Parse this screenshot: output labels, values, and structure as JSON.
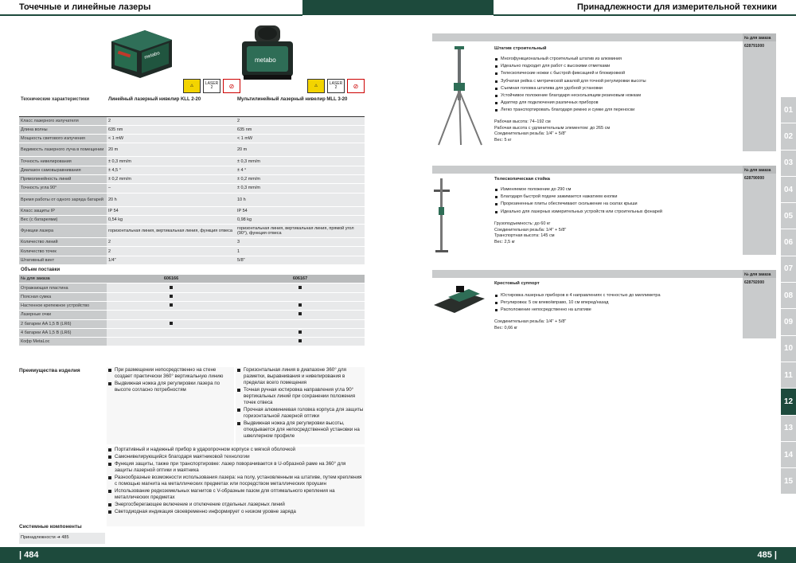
{
  "header": {
    "left_title": "Точечные и линейные лазеры",
    "right_title": "Принадлежности для измерительной техники"
  },
  "footer": {
    "left_page": "| 484",
    "right_page": "485 |"
  },
  "products": [
    {
      "name": "Линейный лазерный нивелир KLL 2-20",
      "brand": "metabo"
    },
    {
      "name": "Мультилинейный лазерный нивелир MLL 3-20",
      "brand": "metabo"
    }
  ],
  "laser_badge": {
    "class_label": "LASER 2",
    "warning": "⚠"
  },
  "spec_table": {
    "header": "Технические характеристики",
    "rows": [
      {
        "k": "Класс лазерного излучателя",
        "v1": "2",
        "v2": "2"
      },
      {
        "k": "Длина волны",
        "v1": "635 nm",
        "v2": "635 nm"
      },
      {
        "k": "Мощность светового излучения",
        "v1": "< 1 mW",
        "v2": "< 1 mW"
      },
      {
        "k": "Видимость лазерного луча в помещении",
        "v1": "20 m",
        "v2": "20 m",
        "tall": true
      },
      {
        "k": "Точность нивелирования",
        "v1": "± 0,3 mm/m",
        "v2": "± 0,3 mm/m"
      },
      {
        "k": "Диапазон самовыравнивания",
        "v1": "± 4,5 °",
        "v2": "± 4 °"
      },
      {
        "k": "Прямолинейность линий",
        "v1": "± 0,2 mm/m",
        "v2": "± 0,2 mm/m"
      },
      {
        "k": "Точность угла 90°",
        "v1": "–",
        "v2": "± 0,3 mm/m"
      },
      {
        "k": "Время работы от одного заряда батарей",
        "v1": "20 h",
        "v2": "10 h",
        "tall": true
      },
      {
        "k": "Класс защиты IP",
        "v1": "IP 54",
        "v2": "IP 54"
      },
      {
        "k": "Вес (с батареями)",
        "v1": "0,54 kg",
        "v2": "0,98 kg"
      },
      {
        "k": "Функции лазера",
        "v1": "горизонтальная линия, вертикальная линия, функция отвеса",
        "v2": "горизонтальная линия, вертикальная линия, прямой угол (90°), функция отвеса",
        "tall": true
      },
      {
        "k": "Количество линий",
        "v1": "2",
        "v2": "3"
      },
      {
        "k": "Количество точек",
        "v1": "2",
        "v2": "1"
      },
      {
        "k": "Штативный винт",
        "v1": "1/4\"",
        "v2": "5/8\""
      }
    ],
    "delivery_title": "Объем поставки",
    "order_label": "№ для заказа",
    "order_numbers": [
      "606166",
      "606167"
    ],
    "delivery_rows": [
      {
        "k": "Отражающая пластина",
        "v1": true,
        "v2": true
      },
      {
        "k": "Поясная сумка",
        "v1": true,
        "v2": false
      },
      {
        "k": "Настенное крепежное устройство",
        "v1": true,
        "v2": true
      },
      {
        "k": "Лазерные очки",
        "v1": false,
        "v2": true
      },
      {
        "k": "2 батареи AA 1,5 В (LR6)",
        "v1": true,
        "v2": false
      },
      {
        "k": "4 батареи AA 1,5 В (LR6)",
        "v1": false,
        "v2": true
      },
      {
        "k": "Кофр MetaLoc",
        "v1": false,
        "v2": true
      }
    ]
  },
  "advantages": {
    "title": "Преимущества изделия",
    "col1": [
      "При размещении непосредственно на стене создает практически 360° вертикальную линию",
      "Выдвижная ножка для регулировки лазера по высоте согласно потребностям"
    ],
    "col2": [
      "Горизонтальная линия в диапазоне 360° для разметки, выравнивания и нивелирования в пределах всего помещения",
      "Точная ручная юстировка направления угла 90° вертикальных линий при сохранении положения точек отвеса",
      "Прочная алюминиевая головка корпуса для защиты горизонтальной лазерной оптики",
      "Выдвижная ножка для регулировки высоты, откидывается для непосредственной установки на швеллерном профиле"
    ],
    "common": [
      "Портативный и надежный прибор в ударопрочном корпусе с мягкой оболочкой",
      "Самонивелирующийся благодаря маятниковой технологии",
      "Функция защиты, также при транспортировке: лазер поворачивается в U-образной раме на 360° для защиты лазерной оптики и маятника",
      "Разнообразные возможности использования лазера: на полу, установленным на штативе, путем крепления с помощью магнита на металлических предметах или посредством металлических проушин",
      "Использование редкоземельных магнитов с V-образным пазом для оптимального крепления на металлических предметах",
      "Энергосберегающее включение и отключение отдельных лазерных линий",
      "Светодиодная индикация своевременно информирует о низком уровне заряда"
    ]
  },
  "system": {
    "title": "Системные компоненты",
    "item": "Принадлежности ➔ 485"
  },
  "accessories": [
    {
      "order_label": "№ для заказа",
      "title": "Штатив строительный",
      "order_no": "628791000",
      "features": [
        "Многофункциональный строительный штатив из алюминия",
        "Идеально подходит для работ с высокими отметками",
        "Телескопические ножки с быстрой фиксацией и блокировкой",
        "Зубчатая рейка с метрической шкалой для точной регулировки высоты",
        "Съемная головка штатива для удобной установки",
        "Устойчивое положение благодаря нескользящим резиновым ножкам",
        "Адаптер для подключения различных приборов",
        "Легко транспортировать благодаря ремню и сумке для переноски"
      ],
      "specs": [
        "Рабочая высота: 74–192 см",
        "Рабочая высота с удлинительным элементом: до 265 см",
        "Соединительная резьба: 1/4\" + 5/8\"",
        "Вес: 5 кг"
      ]
    },
    {
      "order_label": "№ для заказа",
      "title": "Телескопическая стойка",
      "order_no": "628790000",
      "features": [
        "Изменяемое положение до 290 см",
        "Благодаря быстрой подаче зажимается нажатием кнопки",
        "Прорезиненные плиты обеспечивают скольжение на скатах крыши",
        "Идеально для лазерных измерительных устройств или строительных фонарей"
      ],
      "specs": [
        "Грузоподъемность: до 60 кг",
        "Соединительная резьба: 1/4\" + 5/8\"",
        "Транспортная высота: 145 см",
        "Вес: 2,5 кг"
      ]
    },
    {
      "order_label": "№ для заказа",
      "title": "Крестовый суппорт",
      "order_no": "628792000",
      "features": [
        "Юстировка лазерных приборов в 4 направлениях с точностью до миллиметра",
        "Регулировка: 5 см влево/вправо, 10 см вперед/назад",
        "Расположение непосредственно на штативе"
      ],
      "specs": [
        "Соединительная резьба: 1/4\" + 5/8\"",
        "Вес: 0,66 кг"
      ]
    }
  ],
  "chapter_tabs": [
    "01",
    "02",
    "03",
    "04",
    "05",
    "06",
    "07",
    "08",
    "09",
    "10",
    "11",
    "12",
    "13",
    "14",
    "15"
  ],
  "active_tab": "12",
  "colors": {
    "brand_green": "#1d4a3c",
    "laser_yellow": "#f3d400",
    "tab_grey": "#c9cbcc"
  }
}
